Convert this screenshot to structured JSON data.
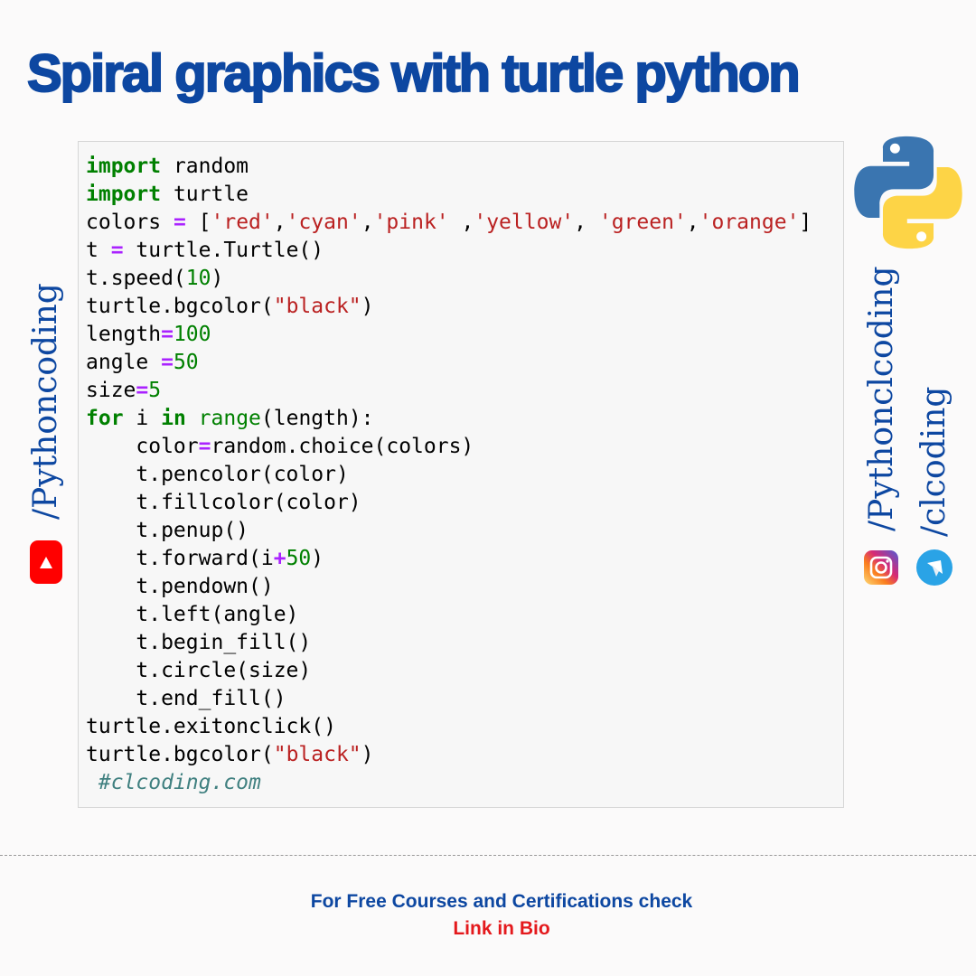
{
  "header": {
    "title": "Spiral graphics with turtle python"
  },
  "code": {
    "lines": [
      [
        {
          "t": "kw",
          "v": "import"
        },
        {
          "t": "plain",
          "v": " random"
        }
      ],
      [
        {
          "t": "kw",
          "v": "import"
        },
        {
          "t": "plain",
          "v": " turtle"
        }
      ],
      [
        {
          "t": "plain",
          "v": "colors "
        },
        {
          "t": "op",
          "v": "="
        },
        {
          "t": "plain",
          "v": " ["
        },
        {
          "t": "str",
          "v": "'red'"
        },
        {
          "t": "plain",
          "v": ","
        },
        {
          "t": "str",
          "v": "'cyan'"
        },
        {
          "t": "plain",
          "v": ","
        },
        {
          "t": "str",
          "v": "'pink'"
        },
        {
          "t": "plain",
          "v": " ,"
        },
        {
          "t": "str",
          "v": "'yellow'"
        },
        {
          "t": "plain",
          "v": ", "
        },
        {
          "t": "str",
          "v": "'green'"
        },
        {
          "t": "plain",
          "v": ","
        },
        {
          "t": "str",
          "v": "'orange'"
        },
        {
          "t": "plain",
          "v": "]"
        }
      ],
      [
        {
          "t": "plain",
          "v": "t "
        },
        {
          "t": "op",
          "v": "="
        },
        {
          "t": "plain",
          "v": " turtle.Turtle()"
        }
      ],
      [
        {
          "t": "plain",
          "v": "t.speed("
        },
        {
          "t": "num",
          "v": "10"
        },
        {
          "t": "plain",
          "v": ")"
        }
      ],
      [
        {
          "t": "plain",
          "v": "turtle.bgcolor("
        },
        {
          "t": "str",
          "v": "\"black\""
        },
        {
          "t": "plain",
          "v": ")"
        }
      ],
      [
        {
          "t": "plain",
          "v": "length"
        },
        {
          "t": "op",
          "v": "="
        },
        {
          "t": "num",
          "v": "100"
        }
      ],
      [
        {
          "t": "plain",
          "v": "angle "
        },
        {
          "t": "op",
          "v": "="
        },
        {
          "t": "num",
          "v": "50"
        }
      ],
      [
        {
          "t": "plain",
          "v": "size"
        },
        {
          "t": "op",
          "v": "="
        },
        {
          "t": "num",
          "v": "5"
        }
      ],
      [
        {
          "t": "kw",
          "v": "for"
        },
        {
          "t": "plain",
          "v": " i "
        },
        {
          "t": "kw",
          "v": "in"
        },
        {
          "t": "plain",
          "v": " "
        },
        {
          "t": "bi",
          "v": "range"
        },
        {
          "t": "plain",
          "v": "(length):"
        }
      ],
      [
        {
          "t": "plain",
          "v": "    color"
        },
        {
          "t": "op",
          "v": "="
        },
        {
          "t": "plain",
          "v": "random.choice(colors)"
        }
      ],
      [
        {
          "t": "plain",
          "v": "    t.pencolor(color)"
        }
      ],
      [
        {
          "t": "plain",
          "v": "    t.fillcolor(color)"
        }
      ],
      [
        {
          "t": "plain",
          "v": "    t.penup()"
        }
      ],
      [
        {
          "t": "plain",
          "v": "    t.forward(i"
        },
        {
          "t": "op",
          "v": "+"
        },
        {
          "t": "num",
          "v": "50"
        },
        {
          "t": "plain",
          "v": ")"
        }
      ],
      [
        {
          "t": "plain",
          "v": "    t.pendown()"
        }
      ],
      [
        {
          "t": "plain",
          "v": "    t.left(angle)"
        }
      ],
      [
        {
          "t": "plain",
          "v": "    t.begin_fill()"
        }
      ],
      [
        {
          "t": "plain",
          "v": "    t.circle(size)"
        }
      ],
      [
        {
          "t": "plain",
          "v": "    t.end_fill()"
        }
      ],
      [
        {
          "t": "plain",
          "v": "turtle.exitonclick()"
        }
      ],
      [
        {
          "t": "plain",
          "v": "turtle.bgcolor("
        },
        {
          "t": "str",
          "v": "\"black\""
        },
        {
          "t": "plain",
          "v": ")"
        }
      ],
      [
        {
          "t": "plain",
          "v": " "
        },
        {
          "t": "cmt",
          "v": "#clcoding.com"
        }
      ]
    ]
  },
  "social": {
    "youtube_handle": "/Pythoncoding",
    "instagram_handle": "/Pythonclcoding",
    "telegram_handle": "/clcoding",
    "icons": [
      "youtube-icon",
      "instagram-icon",
      "telegram-icon",
      "python-logo-icon"
    ]
  },
  "footer": {
    "line1": "For Free Courses and Certifications check",
    "line2": "Link in Bio"
  },
  "colors": {
    "brand_blue": "#0d47a1",
    "footer_red": "#e4191c",
    "keyword_green": "#008000",
    "operator_purple": "#aa22ff",
    "string_red": "#ba2121",
    "comment_teal": "#408080",
    "youtube_red": "#ff0000",
    "telegram_blue": "#2aa3e6"
  }
}
